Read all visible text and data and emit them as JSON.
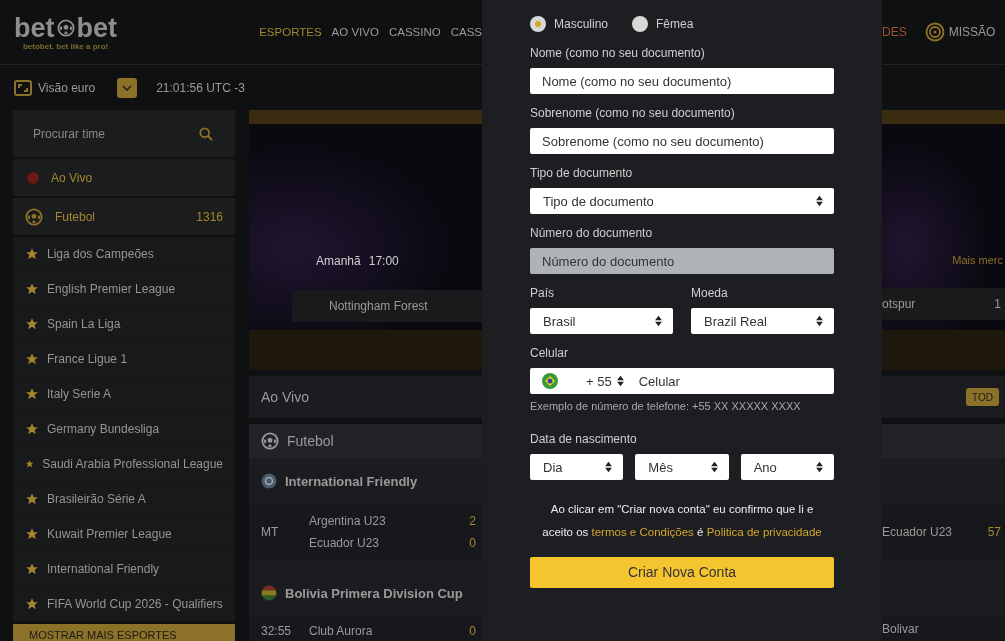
{
  "header": {
    "logo": {
      "left": "bet",
      "right": "bet",
      "tagline": "betobet. bet like a pro!"
    },
    "nav": [
      {
        "label": "ESPORTES",
        "selected": true
      },
      {
        "label": "AO VIVO",
        "selected": false
      },
      {
        "label": "CASSINO",
        "selected": false
      },
      {
        "label": "CASS",
        "selected": false
      }
    ],
    "right_nav": [
      {
        "kind": "promo",
        "label": "DES"
      },
      {
        "kind": "mission",
        "label": "MISSÃO"
      }
    ]
  },
  "toolbar": {
    "view_label": "Visão euro",
    "time": "21:01:56 UTC -3"
  },
  "sidebar": {
    "search": {
      "placeholder": "Procurar time"
    },
    "live": "Ao Vivo",
    "sport": {
      "label": "Futebol",
      "count": "1316"
    },
    "leagues": [
      "Liga dos Campeões",
      "English Premier League",
      "Spain La Liga",
      "France Ligue 1",
      "Italy Serie A",
      "Germany Bundesliga",
      "Saudi Arabia Professional League",
      "Brasileirão Série A",
      "Kuwait Premier League",
      "International Friendly",
      "FIFA World Cup 2026 - Qualifiers"
    ],
    "more_button": "MOSTRAR MAIS ESPORTES"
  },
  "banner": {
    "day": "Amanhã",
    "time": "17:00",
    "home_team": "Nottingham Forest",
    "more_markets": "Mais merc",
    "away_team": "otspur",
    "away_value": "1"
  },
  "live_section": {
    "title": "Ao Vivo",
    "all_button": "TOD",
    "sport": "Futebol",
    "competitions": [
      {
        "kind": "globe",
        "name": "International Friendly",
        "match": {
          "clock": "MT",
          "home": "Argentina U23",
          "away": "Ecuador U23",
          "home_score": "2",
          "away_score": "0",
          "right_team": "Ecuador U23",
          "right_value": "57"
        }
      },
      {
        "kind": "flag",
        "name": "Bolivia Primera Division Cup",
        "match": {
          "clock": "32:55",
          "home": "Club Aurora",
          "home_score": "0",
          "right_team": "Bolivar"
        }
      }
    ]
  },
  "signup": {
    "gender": [
      {
        "label": "Masculino",
        "selected": true
      },
      {
        "label": "Fêmea",
        "selected": false
      }
    ],
    "rows": [
      {
        "fields": [
          {
            "kind": "text",
            "label": "Nome (como no seu documento)",
            "placeholder": "Nome (como no seu documento)",
            "disabled": false
          }
        ]
      },
      {
        "fields": [
          {
            "kind": "text",
            "label": "Sobrenome (como no seu documento)",
            "placeholder": "Sobrenome (como no seu documento)",
            "disabled": false
          }
        ]
      },
      {
        "fields": [
          {
            "kind": "select",
            "label": "Tipo de documento",
            "value": "Tipo de documento"
          }
        ]
      },
      {
        "fields": [
          {
            "kind": "text",
            "label": "Número do documento",
            "placeholder": "Número do documento",
            "disabled": true
          }
        ]
      },
      {
        "fields": [
          {
            "kind": "select",
            "label": "País",
            "value": "Brasil"
          },
          {
            "kind": "select",
            "label": "Moeda",
            "value": "Brazil Real"
          }
        ]
      }
    ],
    "phone": {
      "label": "Celular",
      "code": "+ 55",
      "placeholder": "Celular",
      "hint": "Exemplo de número de telefone: +55 XX XXXXX XXXX"
    },
    "birth": {
      "label": "Data de nascimento",
      "selects": [
        "Dia",
        "Mês",
        "Ano"
      ]
    },
    "terms": {
      "text": "Ao clicar em \"Criar nova conta\" eu confirmo que li e aceito os",
      "terms_link": "termos e Condições",
      "joiner": "é",
      "privacy_link": "Politica de privacidade"
    },
    "submit": "Criar Nova Conta"
  }
}
